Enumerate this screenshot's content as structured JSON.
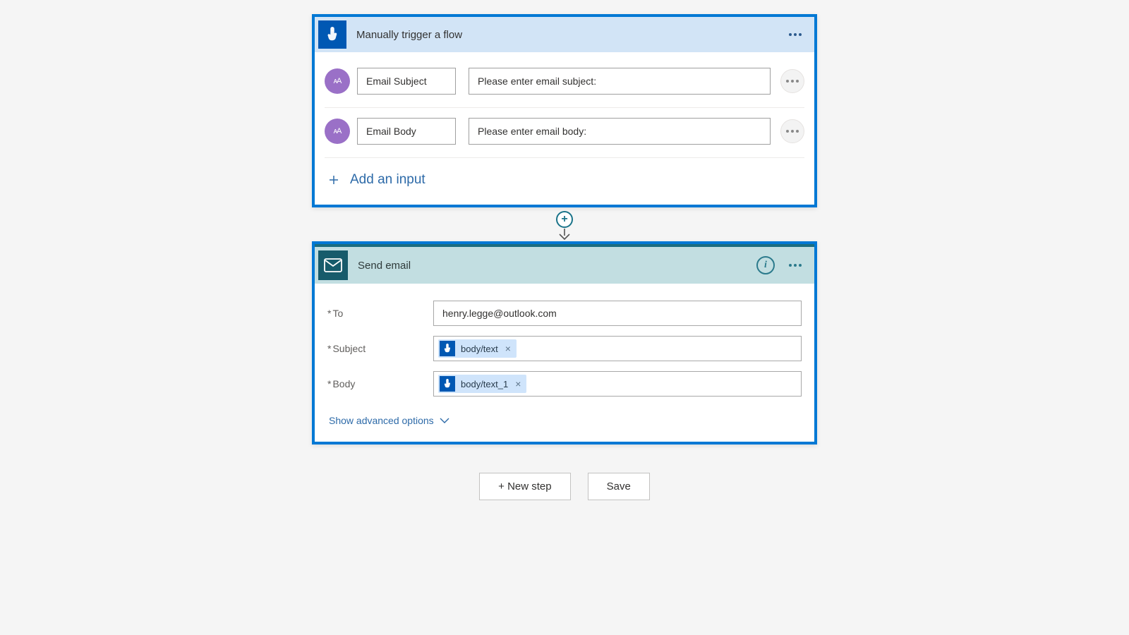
{
  "trigger": {
    "title": "Manually trigger a flow",
    "add_input_label": "Add an input",
    "inputs": [
      {
        "badge": "ᴀA",
        "name": "Email Subject",
        "placeholder": "Please enter email subject:"
      },
      {
        "badge": "ᴀA",
        "name": "Email Body",
        "placeholder": "Please enter email body:"
      }
    ]
  },
  "action": {
    "title": "Send email",
    "advanced_label": "Show advanced options",
    "fields": {
      "to": {
        "label": "To",
        "value": "henry.legge@outlook.com"
      },
      "subject": {
        "label": "Subject",
        "token": "body/text"
      },
      "body": {
        "label": "Body",
        "token": "body/text_1"
      }
    }
  },
  "buttons": {
    "new_step": "+ New step",
    "save": "Save"
  }
}
